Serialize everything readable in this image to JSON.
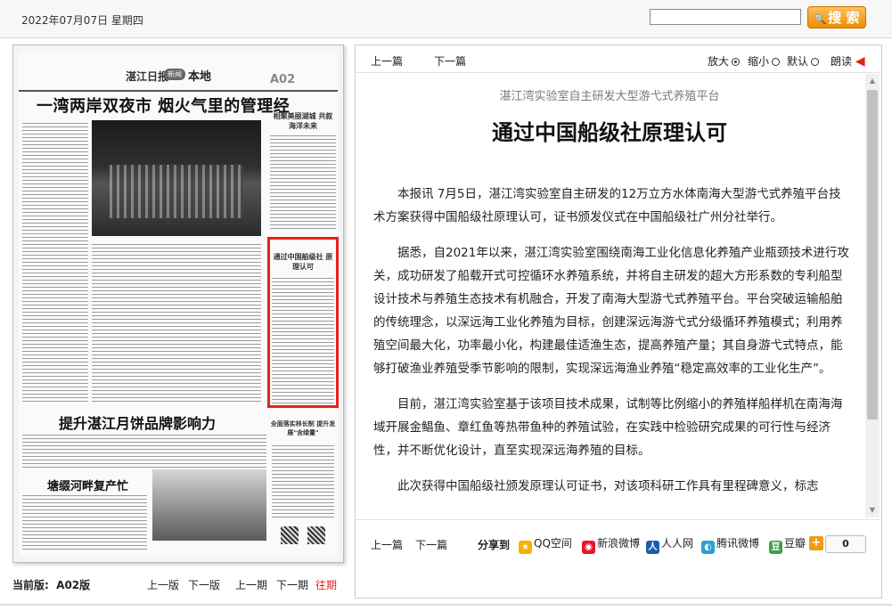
{
  "header": {
    "date": "2022年07月07日 星期四",
    "search_placeholder": "",
    "search_label": "搜 索"
  },
  "paper": {
    "masthead_logo": "湛江日报",
    "masthead_pill": "新闻",
    "section": "本地",
    "edition": "A02",
    "headline_main": "一湾两岸双夜市 烟火气里的管理经",
    "headline_side1": "相聚美丽湖城 共叙海洋未来",
    "highlight_title": "通过中国船级社 原理认可",
    "headline_mid": "提升湛江月饼品牌影响力",
    "headline_low": "塘缀河畔复产忙",
    "side_bottom": "全面落实林长制 提升发展\"含绿量\""
  },
  "pager": {
    "current_label": "当前版:",
    "current_value": "A02版",
    "prev_edition": "上一版",
    "next_edition": "下一版",
    "prev_issue": "上一期",
    "next_issue": "下一期",
    "archive": "往期"
  },
  "toolbar": {
    "prev_article": "上一篇",
    "next_article": "下一篇",
    "zoom_in": "放大",
    "zoom_out": "缩小",
    "default": "默认",
    "read_aloud": "朗读"
  },
  "article": {
    "subhead": "湛江湾实验室自主研发大型游弋式养殖平台",
    "title": "通过中国船级社原理认可",
    "paragraphs": [
      "本报讯 7月5日，湛江湾实验室自主研发的12万立方水体南海大型游弋式养殖平台技术方案获得中国船级社原理认可，证书颁发仪式在中国船级社广州分社举行。",
      "据悉，自2021年以来，湛江湾实验室围绕南海工业化信息化养殖产业瓶颈技术进行攻关，成功研发了船载开式可控循环水养殖系统，并将自主研发的超大方形系数的专利船型设计技术与养殖生态技术有机融合，开发了南海大型游弋式养殖平台。平台突破运输船舶的传统理念，以深远海工业化养殖为目标，创建深远海游弋式分级循环养殖模式；利用养殖空间最大化，功率最小化，构建最佳适渔生态，提高养殖产量；其自身游弋式特点，能够打破渔业养殖受季节影响的限制，实现深远海渔业养殖“稳定高效率的工业化生产”。",
      "目前，湛江湾实验室基于该项目技术成果，试制等比例缩小的养殖样船样机在南海海域开展金鲳鱼、章红鱼等热带鱼种的养殖试验，在实践中检验研究成果的可行性与经济性，并不断优化设计，直至实现深远海养殖的目标。",
      "此次获得中国船级社颁发原理认可证书，对该项科研工作具有里程碑意义，标志"
    ]
  },
  "footer": {
    "prev_article": "上一篇",
    "next_article": "下一篇",
    "share_label": "分享到",
    "share": [
      {
        "label": "QQ空间",
        "icon": "qzone-icon",
        "color": "#f5b000",
        "glyph": "★"
      },
      {
        "label": "新浪微博",
        "icon": "weibo-icon",
        "color": "#e6162d",
        "glyph": "◉"
      },
      {
        "label": "人人网",
        "icon": "renren-icon",
        "color": "#1c5dab",
        "glyph": "人"
      },
      {
        "label": "腾讯微博",
        "icon": "tencent-weibo-icon",
        "color": "#2a9fd6",
        "glyph": "◐"
      },
      {
        "label": "豆瓣",
        "icon": "douban-icon",
        "color": "#3fa142",
        "glyph": "豆"
      }
    ],
    "more_glyph": "+",
    "count": "0"
  },
  "colors": {
    "accent_orange": "#f08c00",
    "highlight_red": "#e8221b",
    "archive_red": "#dd2222"
  }
}
